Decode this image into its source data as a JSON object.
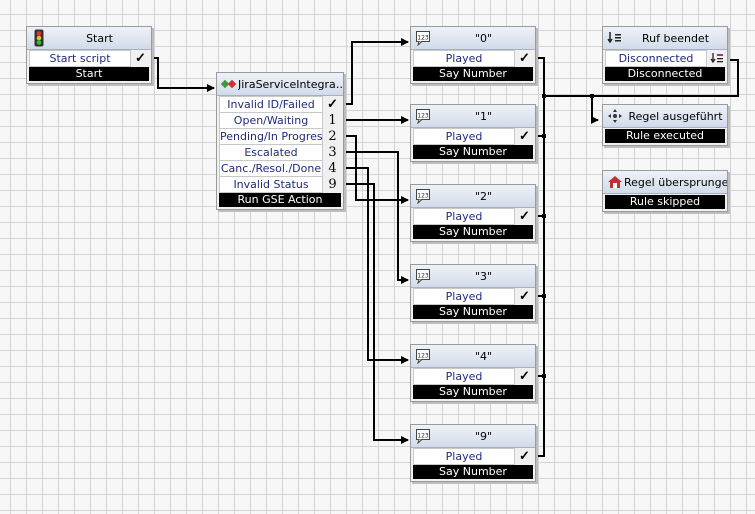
{
  "colors": {
    "check": "#7a9a20",
    "footer_bg": "#000000",
    "label_text": "#1f2a7a"
  },
  "start": {
    "title": "Start",
    "icon": "traffic-light-icon",
    "row": "Start script",
    "footer": "Start"
  },
  "jira": {
    "title": "JiraServiceIntegra…",
    "icon": "jira-service-icon",
    "rows": [
      {
        "label": "Invalid ID/Failed",
        "badge": "✓"
      },
      {
        "label": "Open/Waiting",
        "badge": "1"
      },
      {
        "label": "Pending/In Progress",
        "badge": "2"
      },
      {
        "label": "Escalated",
        "badge": "3"
      },
      {
        "label": "Canc./Resol./Done",
        "badge": "4"
      },
      {
        "label": "Invalid Status",
        "badge": "9"
      }
    ],
    "footer": "Run GSE Action"
  },
  "say_numbers": [
    {
      "title": "\"0\"",
      "row": "Played",
      "footer": "Say Number"
    },
    {
      "title": "\"1\"",
      "row": "Played",
      "footer": "Say Number"
    },
    {
      "title": "\"2\"",
      "row": "Played",
      "footer": "Say Number"
    },
    {
      "title": "\"3\"",
      "row": "Played",
      "footer": "Say Number"
    },
    {
      "title": "\"4\"",
      "row": "Played",
      "footer": "Say Number"
    },
    {
      "title": "\"9\"",
      "row": "Played",
      "footer": "Say Number"
    }
  ],
  "ruf": {
    "title": "Ruf beendet",
    "icon": "hangup-icon",
    "row": "Disconnected",
    "footer": "Disconnected"
  },
  "regel_a": {
    "title": "Regel ausgeführt",
    "icon": "rule-executed-icon",
    "footer": "Rule executed"
  },
  "regel_s": {
    "title": "Regel übersprungen",
    "icon": "rule-skipped-icon",
    "footer": "Rule skipped"
  }
}
